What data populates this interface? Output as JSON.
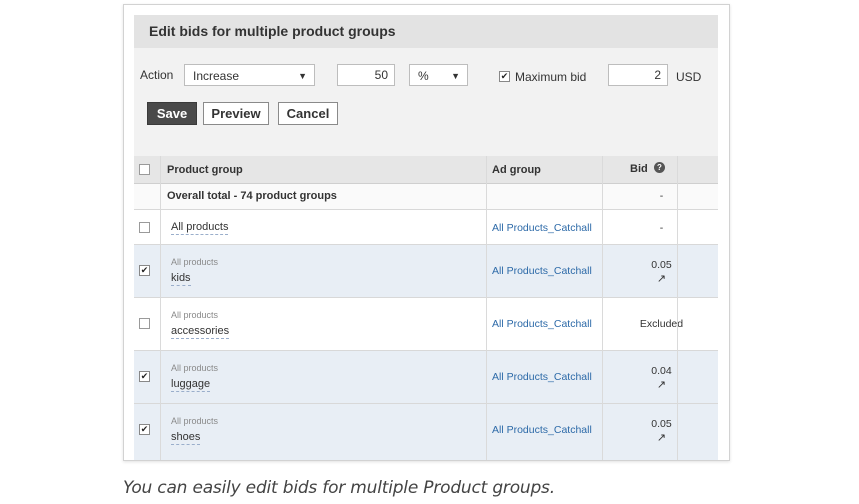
{
  "dialog": {
    "title": "Edit bids for multiple product groups",
    "action_label": "Action",
    "action_value": "Increase",
    "amount_value": "50",
    "unit_value": "%",
    "max_bid_checked": true,
    "max_bid_label": "Maximum bid",
    "max_bid_value": "2",
    "currency": "USD",
    "save_label": "Save",
    "preview_label": "Preview",
    "cancel_label": "Cancel"
  },
  "table": {
    "headers": {
      "product_group": "Product group",
      "ad_group": "Ad group",
      "bid": "Bid"
    },
    "total_row": {
      "label": "Overall total - 74 product groups",
      "bid": "-"
    },
    "rows": [
      {
        "checked": false,
        "parent": "",
        "name": "All products",
        "ad_group": "All Products_Catchall",
        "bid": "-",
        "trend": ""
      },
      {
        "checked": true,
        "parent": "All products",
        "name": "kids",
        "ad_group": "All Products_Catchall",
        "bid": "0.05",
        "trend": "↗"
      },
      {
        "checked": false,
        "parent": "All products",
        "name": "accessories",
        "ad_group": "All Products_Catchall",
        "bid": "Excluded",
        "trend": ""
      },
      {
        "checked": true,
        "parent": "All products",
        "name": "luggage",
        "ad_group": "All Products_Catchall",
        "bid": "0.04",
        "trend": "↗"
      },
      {
        "checked": true,
        "parent": "All products",
        "name": "shoes",
        "ad_group": "All Products_Catchall",
        "bid": "0.05",
        "trend": "↗"
      }
    ]
  },
  "caption": "You can easily edit bids for multiple Product groups.",
  "colors": {
    "selected_row": "#e8eef5",
    "link": "#2d6aa8",
    "primary_button": "#4a4a4a"
  }
}
